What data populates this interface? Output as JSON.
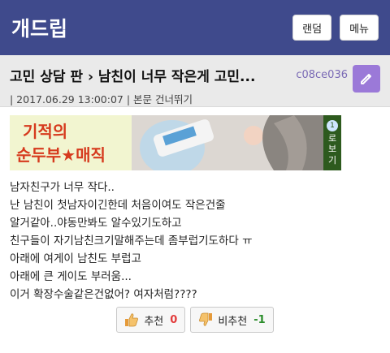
{
  "header": {
    "logo": "개드립",
    "random_label": "랜덤",
    "menu_label": "메뉴",
    "bg_color": "#3f4a8c"
  },
  "post": {
    "title": "고민 상담 판 › 남친이 너무 작은게 고민...",
    "author": "c08ce036",
    "meta": "| 2017.06.29 13:00:07 | 본문 건너뛰기",
    "edit_icon": "pencil-icon",
    "body_lines": [
      "남자친구가 너무 작다..",
      "난 남친이 첫남자이긴한데 처음이여도 작은건줄",
      "알거같아..야동만봐도 알수있기도하고",
      "친구들이 자기남친크기말해주는데 좀부럽기도하다 ㅠ",
      "아래에 여게이 남친도 부럽고",
      "아래에 큰 게이도 부러움...",
      "이거 확장수술같은건없어? 여자처럼????"
    ]
  },
  "banner": {
    "line1": "기적의",
    "line2": "순두부★매직",
    "side_num": "1",
    "side_text": [
      "로",
      "보",
      "기"
    ]
  },
  "votes": {
    "up_label": "추천",
    "up_count": "0",
    "up_icon": "thumbs-up-icon",
    "down_label": "비추천",
    "down_count": "-1",
    "down_icon": "thumbs-down-icon"
  }
}
